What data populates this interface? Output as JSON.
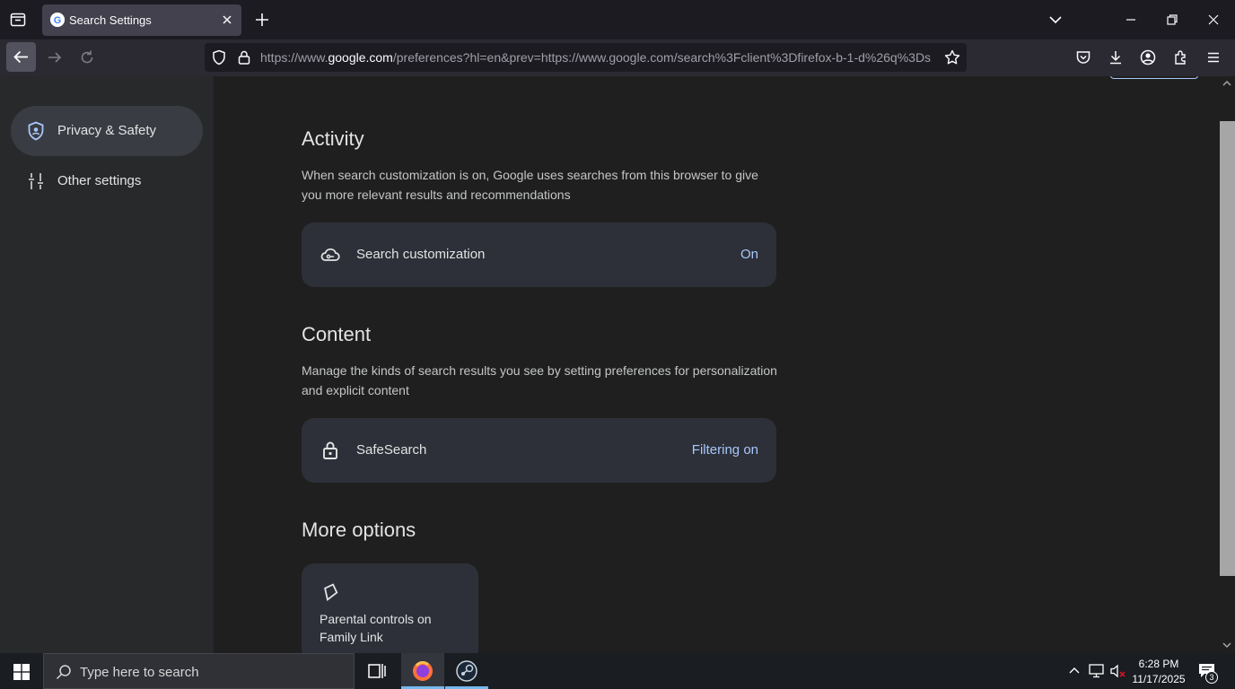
{
  "browser": {
    "tab_title": "Search Settings",
    "url_prefix": "https://www.",
    "url_domain": "google.com",
    "url_suffix": "/preferences?hl=en&prev=https://www.google.com/search%3Fclient%3Dfirefox-b-1-d%26q%3Ds"
  },
  "sidebar": {
    "items": [
      {
        "label": "Privacy & Safety",
        "icon": "shield-icon",
        "active": true
      },
      {
        "label": "Other settings",
        "icon": "sliders-icon",
        "active": false
      }
    ]
  },
  "main": {
    "activity": {
      "heading": "Activity",
      "description": "When search customization is on, Google uses searches from this browser to give you more relevant results and recommendations",
      "card_label": "Search customization",
      "card_value": "On"
    },
    "content": {
      "heading": "Content",
      "description": "Manage the kinds of search results you see by setting preferences for personalization and explicit content",
      "card_label": "SafeSearch",
      "card_value": "Filtering on"
    },
    "more": {
      "heading": "More options",
      "card_label": "Parental controls on Family Link"
    }
  },
  "taskbar": {
    "search_placeholder": "Type here to search",
    "time": "6:28 PM",
    "date": "11/17/2025",
    "notification_count": "3"
  },
  "colors": {
    "accent": "#a8c7fa",
    "card_bg": "#2d3039",
    "page_bg": "#1f1f1f"
  }
}
